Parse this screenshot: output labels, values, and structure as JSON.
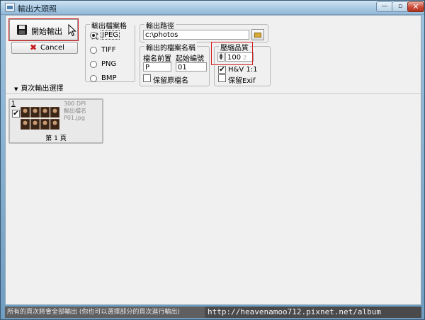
{
  "window": {
    "title": "輸出大頭照",
    "minimize_glyph": "—",
    "maximize_glyph": "▫",
    "close_glyph": "✕"
  },
  "actions": {
    "start_label": "開始輸出",
    "cancel_label": "Cancel",
    "cancel_glyph": "✖"
  },
  "format": {
    "legend": "輸出檔案格式",
    "options": [
      {
        "label": "JPEG",
        "selected": true
      },
      {
        "label": "TIFF",
        "selected": false
      },
      {
        "label": "PNG",
        "selected": false
      },
      {
        "label": "BMP",
        "selected": false
      }
    ]
  },
  "output_path": {
    "legend": "輸出路徑",
    "value": "c:\\photos"
  },
  "file_name": {
    "legend": "輸出的檔案名稱",
    "prefix_label": "檔名前置",
    "start_number_label": "起始編號",
    "prefix_value": "P",
    "start_number_value": "01",
    "keep_original_label": "保留原檔名",
    "keep_original_checked": false
  },
  "compression": {
    "legend": "壓縮品質",
    "quality_value": "100",
    "quality_suffix": "z",
    "hv_label": "H&V 1:1",
    "hv_checked": true,
    "exif_label": "保留Exif",
    "exif_checked": false
  },
  "pages_section": {
    "toggle_label": "頁次輸出選擇",
    "toggle_glyph": "▼"
  },
  "page_card": {
    "number": "1",
    "checked": true,
    "dpi": "300 DPI",
    "name_label": "輸出檔名",
    "file_name": "P01.jpg",
    "caption": "第 1 頁",
    "thumbnail_count": 8
  },
  "status": {
    "text": "所有的頁次將會全部輸出 (你也可以選擇部分的頁次進行輸出)",
    "watermark": "http://heavenamoo712.pixnet.net/album"
  }
}
